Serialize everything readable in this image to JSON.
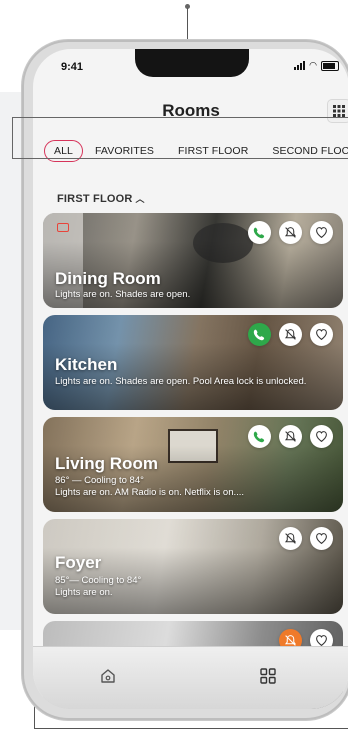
{
  "status": {
    "time": "9:41"
  },
  "header": {
    "title": "Rooms",
    "grid_icon": "apps-grid-icon"
  },
  "tabs": [
    {
      "label": "ALL",
      "active": true
    },
    {
      "label": "FAVORITES",
      "active": false
    },
    {
      "label": "FIRST FLOOR",
      "active": false
    },
    {
      "label": "SECOND FLOC",
      "active": false
    }
  ],
  "section": {
    "label": "FIRST FLOOR"
  },
  "rooms": [
    {
      "name": "Dining Room",
      "desc": "Lights are on. Shades are open.",
      "icons": [
        "phone",
        "bell-off",
        "heart"
      ]
    },
    {
      "name": "Kitchen",
      "desc": "Lights are on. Shades are open. Pool Area lock is unlocked.",
      "icons": [
        "phone",
        "bell-off",
        "heart"
      ]
    },
    {
      "name": "Living Room",
      "desc": "86° — Cooling to 84°\nLights are on. AM Radio is on. Netflix is on....",
      "icons": [
        "phone",
        "bell-off",
        "heart"
      ]
    },
    {
      "name": "Foyer",
      "desc": "85°— Cooling to 84°\nLights are on.",
      "icons": [
        "bell-off",
        "heart"
      ]
    },
    {
      "name": "",
      "desc": "",
      "icons": [
        "bell-off",
        "heart"
      ]
    }
  ],
  "colors": {
    "accent": "#d6345a",
    "call_green": "#2ea84a",
    "alert_orange": "#ef7a2a"
  },
  "bottom_nav": [
    {
      "icon": "home-icon"
    },
    {
      "icon": "grid-icon"
    }
  ]
}
